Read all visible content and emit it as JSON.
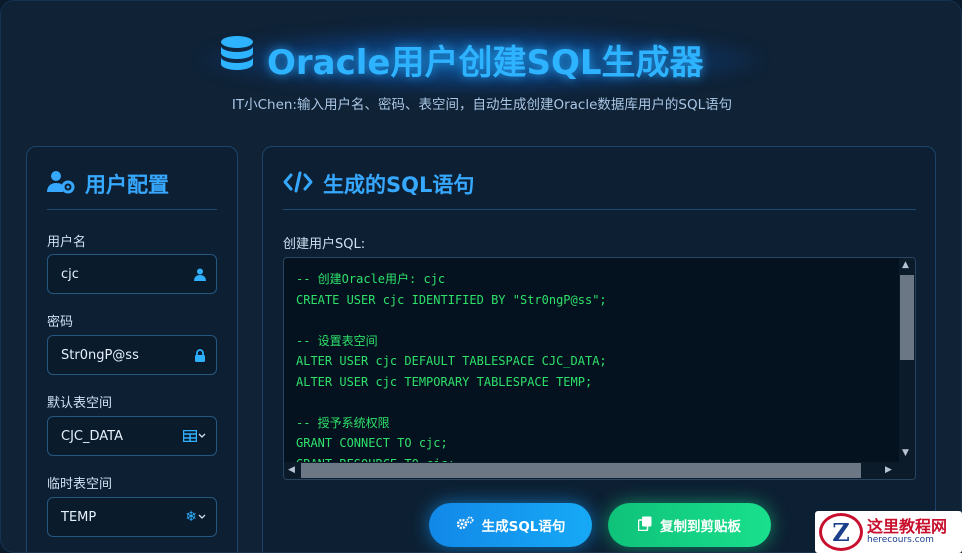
{
  "header": {
    "title": "Oracle用户创建SQL生成器",
    "subtitle": "IT小Chen:输入用户名、密码、表空间，自动生成创建Oracle数据库用户的SQL语句"
  },
  "config_panel": {
    "title": "用户配置",
    "username_label": "用户名",
    "username_value": "cjc",
    "password_label": "密码",
    "password_value": "Str0ngP@ss",
    "default_ts_label": "默认表空间",
    "default_ts_value": "CJC_DATA",
    "temp_ts_label": "临时表空间",
    "temp_ts_value": "TEMP"
  },
  "sql_panel": {
    "title": "生成的SQL语句",
    "create_label": "创建用户SQL:",
    "code_lines": [
      "-- 创建Oracle用户: cjc",
      "CREATE USER cjc IDENTIFIED BY \"Str0ngP@ss\";",
      "",
      "-- 设置表空间",
      "ALTER USER cjc DEFAULT TABLESPACE CJC_DATA;",
      "ALTER USER cjc TEMPORARY TABLESPACE TEMP;",
      "",
      "-- 授予系统权限",
      "GRANT CONNECT TO cjc;",
      "GRANT RESOURCE TO cjc;"
    ]
  },
  "buttons": {
    "generate_label": "生成SQL语句",
    "copy_label": "复制到剪贴板"
  },
  "watermark": {
    "logo_letter": "Z",
    "name": "这里教程网",
    "domain": "herecours.com"
  },
  "colors": {
    "accent": "#2db3ff",
    "code_green": "#2ee06a",
    "generate_button": "#1288e8",
    "copy_button": "#19e08c"
  }
}
